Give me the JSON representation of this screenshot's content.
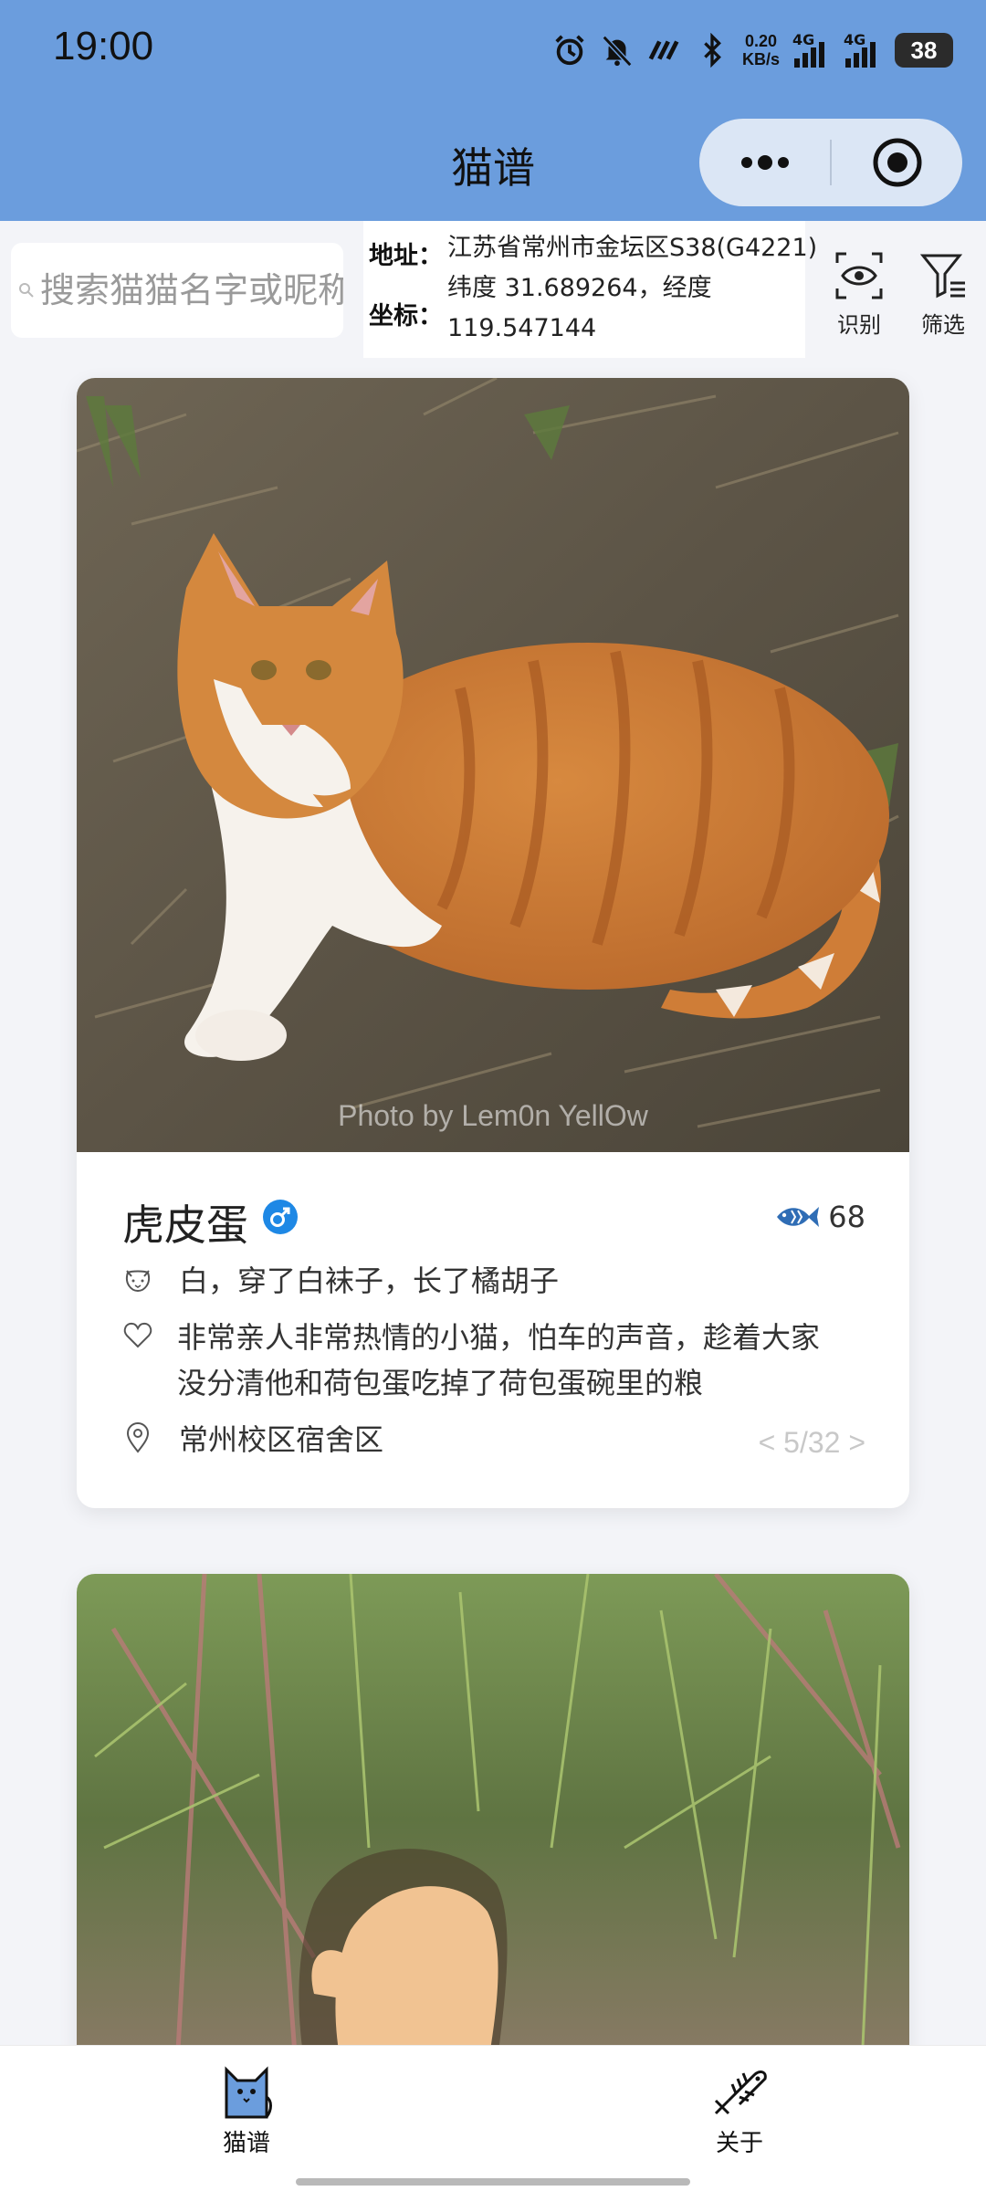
{
  "status_bar": {
    "time": "19:00",
    "net_speed_value": "0.20",
    "net_speed_unit": "KB/s",
    "sim1": "4G",
    "sim2": "4G",
    "battery": "38"
  },
  "nav": {
    "title": "猫谱"
  },
  "search": {
    "placeholder": "搜索猫猫名字或昵称"
  },
  "location": {
    "address_label": "地址：",
    "address_value": "江苏省常州市金坛区S38(G4221)",
    "coord_label": "坐标：",
    "coord_line1": "纬度 31.689264，经度",
    "coord_line2": "119.547144"
  },
  "toolbar": {
    "recognize_label": "识别",
    "filter_label": "筛选"
  },
  "cards": [
    {
      "photo_credit": "Photo by Lem0n YellOw",
      "name": "虎皮蛋",
      "gender": "♂",
      "likes": "68",
      "appearance": "白，穿了白袜子，长了橘胡子",
      "personality_line1": "非常亲人非常热情的小猫，怕车的声音，趁着大家",
      "personality_line2": "没分清他和荷包蛋吃掉了荷包蛋碗里的粮",
      "location": "常州校区宿舍区",
      "pager": "< 5/32 >"
    }
  ],
  "tabbar": {
    "tab1_label": "猫谱",
    "tab2_label": "关于"
  },
  "colors": {
    "header_bg": "#6b9ddd",
    "gender_male": "#1e88e5",
    "fish_icon": "#2f6db5",
    "page_bg": "#f3f4f8"
  }
}
